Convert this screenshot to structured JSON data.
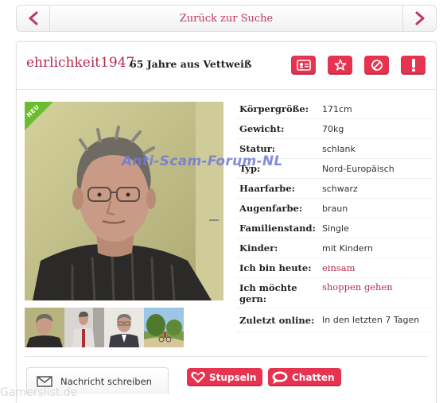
{
  "nav": {
    "back_to_search": "Zurück zur Suche"
  },
  "profile": {
    "username": "ehrlichkeit1947",
    "age_location": "65 Jahre aus Vettweiß",
    "badge": "NEU"
  },
  "attributes": [
    {
      "label": "Körpergröße:",
      "value": "171cm"
    },
    {
      "label": "Gewicht:",
      "value": "70kg"
    },
    {
      "label": "Statur:",
      "value": "schlank"
    },
    {
      "label": "Typ:",
      "value": "Nord-Europäisch"
    },
    {
      "label": "Haarfarbe:",
      "value": "schwarz"
    },
    {
      "label": "Augenfarbe:",
      "value": "braun"
    },
    {
      "label": "Familienstand:",
      "value": "Single"
    },
    {
      "label": "Kinder:",
      "value": "mit Kindern"
    },
    {
      "label": "Ich bin heute:",
      "value": "einsam"
    },
    {
      "label": "Ich möchte gern:",
      "value": "shoppen gehen"
    },
    {
      "label": "Zuletzt online:",
      "value": "In den letzten 7 Tagen"
    }
  ],
  "watermark": "Anti-Scam-Forum-NL",
  "actions": {
    "message_tab": "Nachricht schreiben",
    "stupseln": "Stupseln",
    "chatten": "Chatten"
  },
  "footer_watermark": "Gamerslist.de",
  "colors": {
    "accent": "#e63350",
    "link": "#b8294d",
    "new_badge": "#6cbd2e"
  },
  "icons": [
    "chevron-left-icon",
    "chevron-right-icon",
    "profile-card-icon",
    "star-icon",
    "block-icon",
    "exclamation-icon",
    "envelope-icon",
    "heart-icon",
    "chat-bubble-icon"
  ]
}
